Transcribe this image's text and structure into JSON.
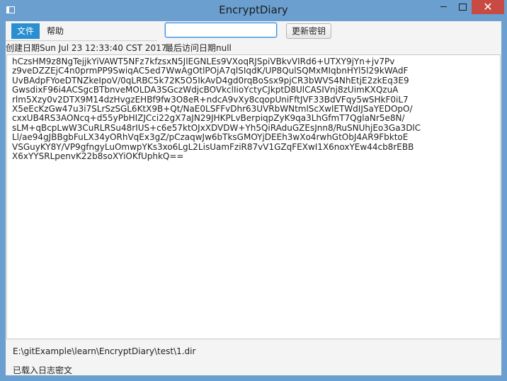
{
  "window": {
    "title": "EncryptDiary",
    "close_glyph": "✕"
  },
  "menu": {
    "file": "文件",
    "help": "帮助"
  },
  "toolbar": {
    "key_input_value": "",
    "update_key_button": "更新密钥"
  },
  "info": {
    "created": "创建日期Sun Jul 23 12:33:40 CST 2017",
    "last_visited": "最后访问日期null"
  },
  "editor": {
    "content": "hCzsHM9z8NgTejjkYiVAWT5NFz7kfzsxN5JlEGNLEs9VXoqRJSpiVBkvVIRd6+UTXY9jYn+jv7Pv\nz9veDZZEjC4n0prmPP9SwiqAC5ed7WwAgOtlPOjA7qlSIqdK/UP8QulSQMxMIqbnHYl5l29kWAdF\nUvBAdpFYoeDTNZkeIpoV/0qLRBC5k72K5O5IkAvD4gd0rqBoSsx9pjCR3bWVS4NhEtjE2zkEq3E9\nGwsdixF96i4ACSgcBTbnveMOLDA3SGczWdjcBOVkclIioYctyCJkptD8UlCASIVnj8zUimKXQzuA\nrlm5Xzy0v2DTX9M14dzHvgzEHBf9fw3O8eR+ndcA9vXy8cqopUniFftJVF33BdVFqy5wSHkF0iL7\nX5eEcKzGw47u3i7SLrSzSGL6KtX9B+Qt/NaE0LSFFvDhr63UVRbWNtmlScXwlETWdIJSaYEDOpO/\ncxxUB4RS3AONcq+d55yPbHIZJCci22gX7aJN29JHKPLvBerpiqpZyK9qa3LhGfmT7QglaNr5e8N/\nsLM+qBcpLwW3CuRLRSu48rIUS+c6e57ktOJxXDVDW+Yh5QiRAduGZEsJnn8/RuSNUhjEo3Ga3DlC\nLl/ae94gJBBgbFuLX34yORhVqEx3gZ/pCzaqwJw6bTksGMOYjDEEh3wXo4rwhGtObJ4AR9FbktoE\nVSGuyKY8Y/VP9gfngyLuOmwpYKs3xo6LgL2LisUamFziR87vV1GZqFEXwI1X6noxYEw44cb8rEBB\nX6xYYSRLpenvK22b8soXYiOKfUphkQ=="
  },
  "status": {
    "file_path": "E:\\gitExample\\learn\\EncryptDiary\\test\\1.dir",
    "message": "已载入日志密文"
  }
}
